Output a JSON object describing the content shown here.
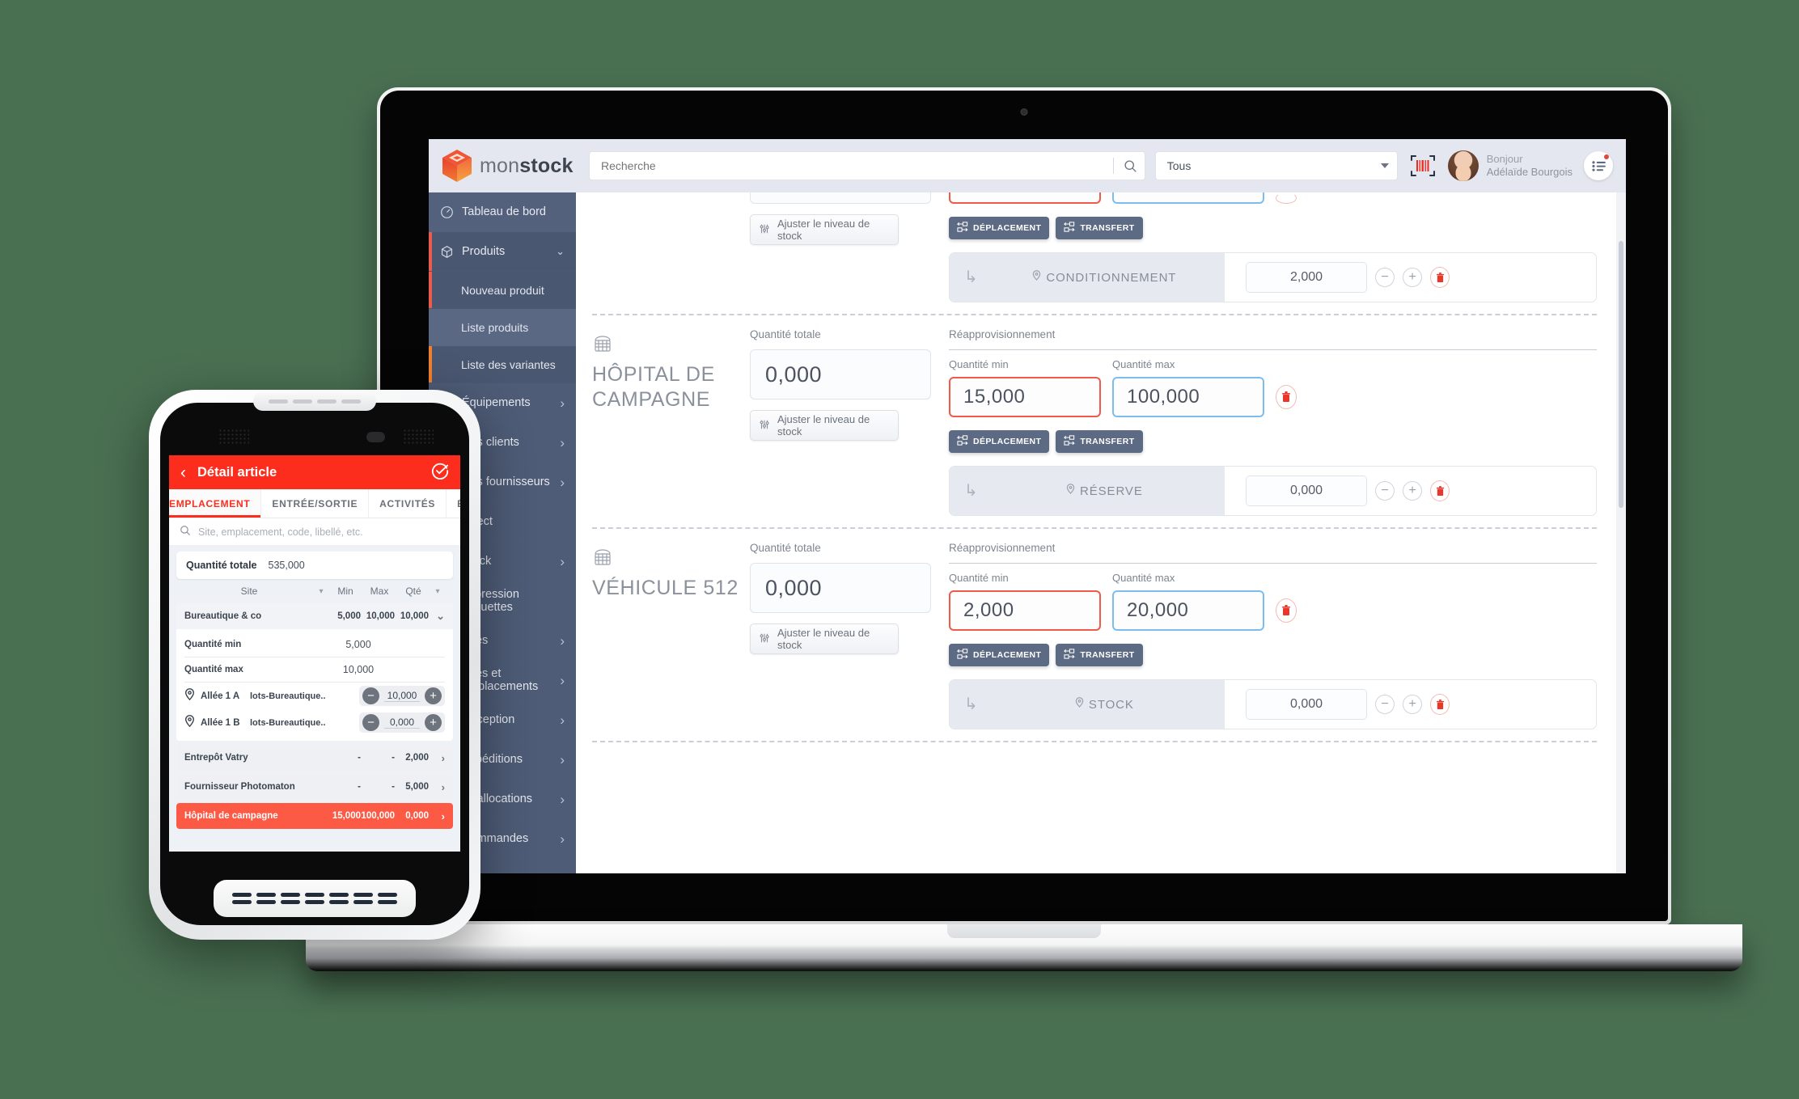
{
  "background_color": "#4a7052",
  "desktop": {
    "brand": {
      "name_light": "mon",
      "name_bold": "stock",
      "logo_icon": "cube-logo-icon"
    },
    "search": {
      "placeholder": "Recherche",
      "icon": "search-icon"
    },
    "filter": {
      "value": "Tous",
      "icon": "chevron-down-icon"
    },
    "barcode_icon": "barcode-scan-icon",
    "user": {
      "greeting": "Bonjour",
      "name": "Adélaïde Bourgois",
      "avatar": "user-avatar"
    },
    "menu_icon": "list-menu-icon",
    "sidebar": {
      "items": [
        {
          "label": "Tableau de bord",
          "icon": "dashboard-icon",
          "expandable": false,
          "state": "top"
        },
        {
          "label": "Produits",
          "icon": "box-icon",
          "expandable": true,
          "state": "expanded"
        },
        {
          "label": "Équipements",
          "icon": "equipment-icon",
          "expandable": true,
          "state": "normal"
        },
        {
          "label": "Des clients",
          "icon": "clients-icon",
          "expandable": true,
          "state": "normal"
        },
        {
          "label": "Des fournisseurs",
          "icon": "suppliers-icon",
          "expandable": true,
          "state": "normal"
        },
        {
          "label": "Direct",
          "icon": "direct-icon",
          "expandable": false,
          "state": "normal"
        },
        {
          "label": "Stock",
          "icon": "stock-icon",
          "expandable": true,
          "state": "normal"
        },
        {
          "label": "Impression étiquettes",
          "icon": "label-print-icon",
          "expandable": false,
          "state": "normal"
        },
        {
          "label": "Sites",
          "icon": "sites-icon",
          "expandable": true,
          "state": "normal"
        },
        {
          "label": "Sites et emplacements",
          "icon": "locations-icon",
          "expandable": true,
          "state": "normal"
        },
        {
          "label": "Réception",
          "icon": "reception-icon",
          "expandable": true,
          "state": "normal"
        },
        {
          "label": "Expéditions",
          "icon": "shipping-icon",
          "expandable": true,
          "state": "normal"
        },
        {
          "label": "Réallocations",
          "icon": "realloc-icon",
          "expandable": true,
          "state": "normal"
        },
        {
          "label": "Commandes",
          "icon": "orders-icon",
          "expandable": true,
          "state": "normal"
        }
      ],
      "sub_items": [
        {
          "label": "Nouveau produit",
          "selected": false
        },
        {
          "label": "Liste produits",
          "selected": true
        },
        {
          "label": "Liste des variantes",
          "selected": false
        }
      ]
    },
    "labels": {
      "quantite_totale": "Quantité totale",
      "reapprovisionnement": "Réapprovisionnement",
      "quantite_min": "Quantité min",
      "quantite_max": "Quantité max",
      "adjust_button": "Ajuster le niveau de stock",
      "deplacement_button": "DÉPLACEMENT",
      "transfert_button": "TRANSFERT",
      "adjust_icon": "sliders-icon",
      "move_icon": "move-boxes-icon",
      "delete_icon": "trash-icon",
      "minus_icon": "minus-icon",
      "plus_icon": "plus-icon",
      "pin_icon": "map-pin-icon",
      "site_icon": "warehouse-icon",
      "branch_icon": "branch-arrow-icon"
    },
    "sites": [
      {
        "name": "",
        "partial": true,
        "total": "",
        "min": "",
        "max": "",
        "location": {
          "name": "CONDITIONNEMENT",
          "qty": "2,000"
        }
      },
      {
        "name": "HÔPITAL DE CAMPAGNE",
        "partial": false,
        "total": "0,000",
        "min": "15,000",
        "max": "100,000",
        "location": {
          "name": "RÉSERVE",
          "qty": "0,000"
        }
      },
      {
        "name": "VÉHICULE 512",
        "partial": false,
        "total": "0,000",
        "min": "2,000",
        "max": "20,000",
        "location": {
          "name": "STOCK",
          "qty": "0,000"
        }
      }
    ]
  },
  "phone": {
    "header": {
      "title": "Détail article",
      "back_icon": "chevron-left-icon",
      "validate_icon": "check-circle-icon"
    },
    "tabs": [
      {
        "label": "EMPLACEMENT",
        "selected": true
      },
      {
        "label": "ENTRÉE/SORTIE",
        "selected": false
      },
      {
        "label": "ACTIVITÉS",
        "selected": false
      },
      {
        "label": "ÉQUIVALENT",
        "selected": false
      }
    ],
    "search": {
      "placeholder": "Site, emplacement, code, libellé, etc.",
      "icon": "search-icon"
    },
    "total": {
      "label": "Quantité totale",
      "value": "535,000"
    },
    "table_headers": [
      "Site",
      "Min",
      "Max",
      "Qté"
    ],
    "rows": [
      {
        "site": "Bureautique & co",
        "min": "5,000",
        "max": "10,000",
        "qte": "10,000",
        "state": "expanded",
        "chevron": "chevron-up-icon",
        "detail": {
          "min_label": "Quantité min",
          "min_value": "5,000",
          "max_label": "Quantité max",
          "max_value": "10,000",
          "locations": [
            {
              "name": "Allée 1 A",
              "lot": "lots-Bureautique..",
              "qty": "10,000"
            },
            {
              "name": "Allée 1 B",
              "lot": "lots-Bureautique..",
              "qty": "0,000"
            }
          ]
        }
      },
      {
        "site": "Entrepôt Vatry",
        "min": "-",
        "max": "-",
        "qte": "2,000",
        "state": "normal",
        "chevron": "chevron-right-icon"
      },
      {
        "site": "Fournisseur Photomaton",
        "min": "-",
        "max": "-",
        "qte": "5,000",
        "state": "normal",
        "chevron": "chevron-right-icon"
      },
      {
        "site": "Hôpital de campagne",
        "min": "15,000",
        "max": "100,000",
        "qte": "0,000",
        "state": "highlighted",
        "chevron": "chevron-right-icon"
      }
    ],
    "nav": {
      "back": "triangle-back-icon",
      "home": "circle-home-icon",
      "recents": "square-recents-icon"
    },
    "accent_color": "#fc2d1c"
  }
}
